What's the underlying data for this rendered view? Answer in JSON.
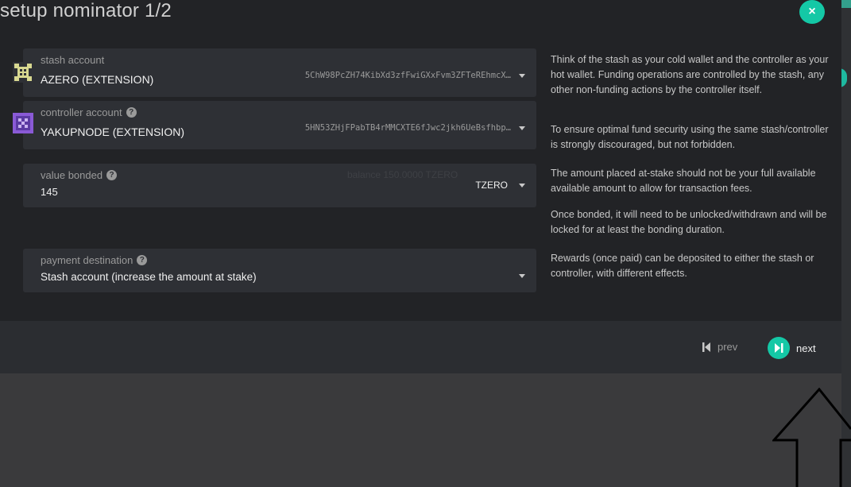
{
  "modal": {
    "title": "setup nominator 1/2",
    "close_icon": "close-icon",
    "close_glyph": "×"
  },
  "stash": {
    "label": "stash account",
    "name": "AZERO (EXTENSION)",
    "address": "5ChW98PcZH74KibXd3zfFwiGXxFvm3ZFTeREhmcX…",
    "icon": "identicon-yellow",
    "icon_color": "#d8d890"
  },
  "controller": {
    "label": "controller account",
    "name": "YAKUPNODE (EXTENSION)",
    "address": "5HN53ZHjFPabTB4rMMCXTE6fJwc2jkh6UeBsfhbp…",
    "icon": "identicon-purple",
    "icon_color": "#8a5ad6"
  },
  "bonded": {
    "label": "value bonded",
    "value": "145",
    "balance": "balance  150.0000 TZERO",
    "unit": "TZERO"
  },
  "payment": {
    "label": "payment destination",
    "value": "Stash account (increase the amount at stake)"
  },
  "help": {
    "stash_1": "Think of the stash as your cold wallet and the controller as your hot wallet. Funding operations are controlled by the stash, any other non-funding actions by the controller itself.",
    "stash_2": "To ensure optimal fund security using the same stash/controller is strongly discouraged, but not forbidden.",
    "bonded_1": "The amount placed at-stake should not be your full available available amount to allow for transaction fees.",
    "bonded_2": "Once bonded, it will need to be unlocked/withdrawn and will be locked for at least the bonding duration.",
    "payment_1": "Rewards (once paid) can be deposited to either the stash or controller, with different effects."
  },
  "footer": {
    "prev_label": "prev",
    "next_label": "next"
  },
  "colors": {
    "accent": "#14c8a6",
    "modal_bg": "#222326",
    "field_bg": "#2e3035"
  }
}
